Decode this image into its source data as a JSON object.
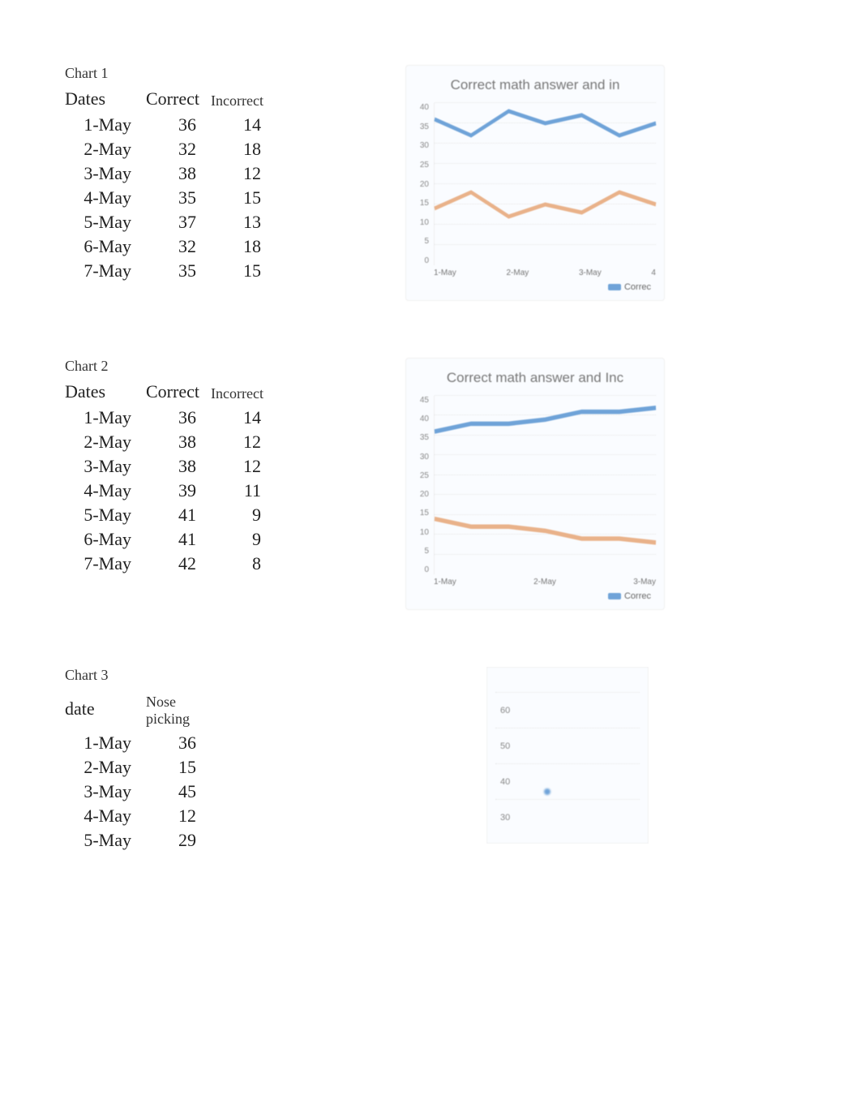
{
  "sections": [
    {
      "heading": "Chart 1",
      "headers": {
        "col0": "Dates",
        "col1": "Correct",
        "col2": "Incorrect"
      },
      "rows": [
        {
          "date": "1-May",
          "correct": "36",
          "incorrect": "14"
        },
        {
          "date": "2-May",
          "correct": "32",
          "incorrect": "18"
        },
        {
          "date": "3-May",
          "correct": "38",
          "incorrect": "12"
        },
        {
          "date": "4-May",
          "correct": "35",
          "incorrect": "15"
        },
        {
          "date": "5-May",
          "correct": "37",
          "incorrect": "13"
        },
        {
          "date": "6-May",
          "correct": "32",
          "incorrect": "18"
        },
        {
          "date": "7-May",
          "correct": "35",
          "incorrect": "15"
        }
      ],
      "chart": {
        "title": "Correct math answer and in",
        "yticks": [
          "0",
          "5",
          "10",
          "15",
          "20",
          "25",
          "30",
          "35",
          "40"
        ],
        "xticks": [
          "1-May",
          "2-May",
          "3-May",
          "4"
        ],
        "legend": "Correc"
      }
    },
    {
      "heading": "Chart 2",
      "headers": {
        "col0": "Dates",
        "col1": "Correct",
        "col2": "Incorrect"
      },
      "rows": [
        {
          "date": "1-May",
          "correct": "36",
          "incorrect": "14"
        },
        {
          "date": "2-May",
          "correct": "38",
          "incorrect": "12"
        },
        {
          "date": "3-May",
          "correct": "38",
          "incorrect": "12"
        },
        {
          "date": "4-May",
          "correct": "39",
          "incorrect": "11"
        },
        {
          "date": "5-May",
          "correct": "41",
          "incorrect": "9"
        },
        {
          "date": "6-May",
          "correct": "41",
          "incorrect": "9"
        },
        {
          "date": "7-May",
          "correct": "42",
          "incorrect": "8"
        }
      ],
      "chart": {
        "title": "Correct math answer and Inc",
        "yticks": [
          "0",
          "5",
          "10",
          "15",
          "20",
          "25",
          "30",
          "35",
          "40",
          "45"
        ],
        "xticks": [
          "1-May",
          "2-May",
          "3-May"
        ],
        "legend": "Correc"
      }
    },
    {
      "heading": "Chart 3",
      "headers": {
        "col0": "date",
        "col1": "Nose picking"
      },
      "rows": [
        {
          "date": "1-May",
          "val": "36"
        },
        {
          "date": "2-May",
          "val": "15"
        },
        {
          "date": "3-May",
          "val": "45"
        },
        {
          "date": "4-May",
          "val": "12"
        },
        {
          "date": "5-May",
          "val": "29"
        }
      ],
      "chart": {
        "yticks": [
          "60",
          "50",
          "40",
          "30"
        ]
      }
    }
  ],
  "chart_data": [
    {
      "type": "line",
      "title": "Correct math answer and in",
      "xlabel": "",
      "ylabel": "",
      "ylim": [
        0,
        40
      ],
      "categories": [
        "1-May",
        "2-May",
        "3-May",
        "4-May",
        "5-May",
        "6-May",
        "7-May"
      ],
      "series": [
        {
          "name": "Correct",
          "values": [
            36,
            32,
            38,
            35,
            37,
            32,
            35
          ],
          "color": "#6fa3d8"
        },
        {
          "name": "Incorrect",
          "values": [
            14,
            18,
            12,
            15,
            13,
            18,
            15
          ],
          "color": "#e9b28a"
        }
      ]
    },
    {
      "type": "line",
      "title": "Correct math answer and Inc",
      "xlabel": "",
      "ylabel": "",
      "ylim": [
        0,
        45
      ],
      "categories": [
        "1-May",
        "2-May",
        "3-May",
        "4-May",
        "5-May",
        "6-May",
        "7-May"
      ],
      "series": [
        {
          "name": "Correct",
          "values": [
            36,
            38,
            38,
            39,
            41,
            41,
            42
          ],
          "color": "#6fa3d8"
        },
        {
          "name": "Incorrect",
          "values": [
            14,
            12,
            12,
            11,
            9,
            9,
            8
          ],
          "color": "#e9b28a"
        }
      ]
    },
    {
      "type": "line",
      "title": "",
      "xlabel": "",
      "ylabel": "",
      "ylim": [
        30,
        60
      ],
      "categories": [
        "1-May",
        "2-May",
        "3-May",
        "4-May",
        "5-May"
      ],
      "series": [
        {
          "name": "Nose picking",
          "values": [
            36,
            15,
            45,
            12,
            29
          ],
          "color": "#6fa3d8"
        }
      ]
    }
  ]
}
